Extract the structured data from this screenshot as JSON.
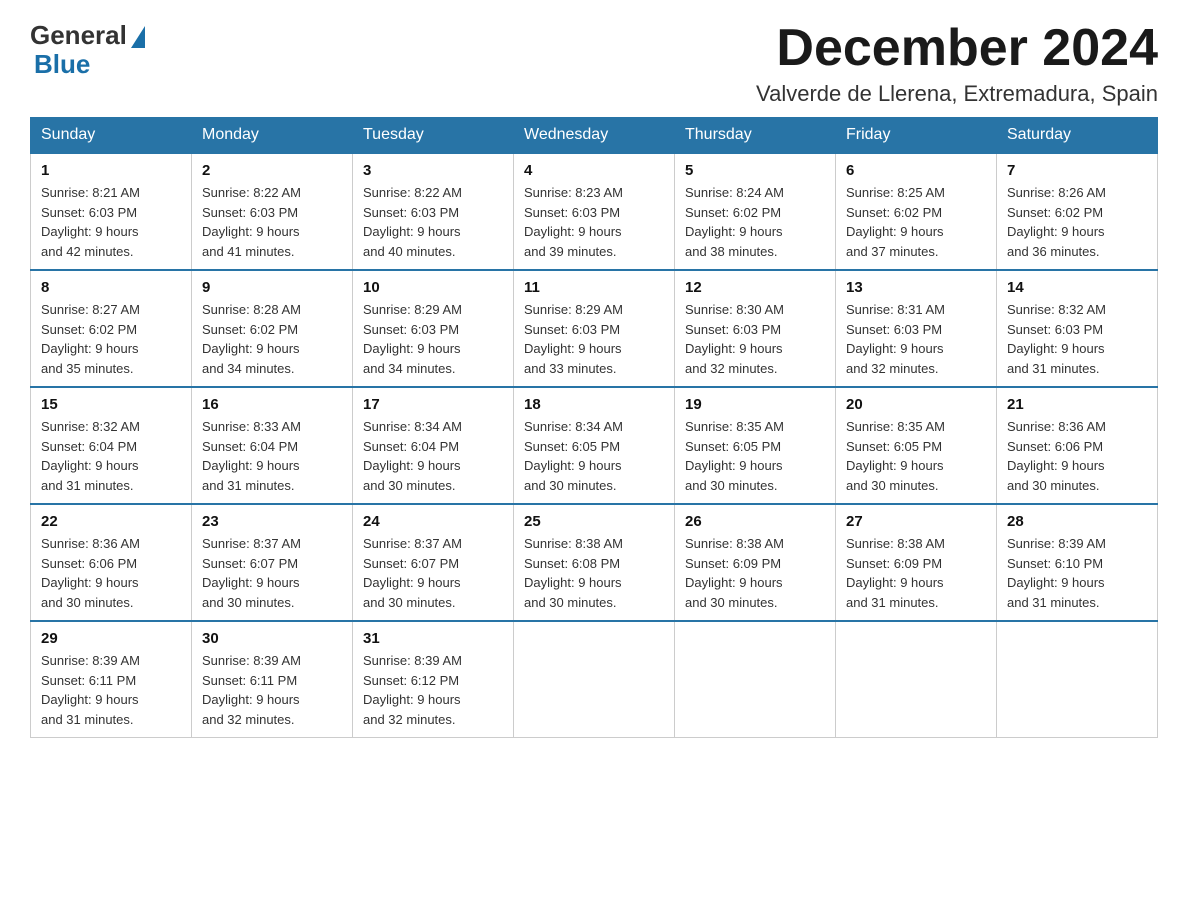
{
  "header": {
    "logo_general": "General",
    "logo_blue": "Blue",
    "month_title": "December 2024",
    "location": "Valverde de Llerena, Extremadura, Spain"
  },
  "weekdays": [
    "Sunday",
    "Monday",
    "Tuesday",
    "Wednesday",
    "Thursday",
    "Friday",
    "Saturday"
  ],
  "weeks": [
    [
      {
        "day": "1",
        "sunrise": "8:21 AM",
        "sunset": "6:03 PM",
        "daylight": "9 hours and 42 minutes."
      },
      {
        "day": "2",
        "sunrise": "8:22 AM",
        "sunset": "6:03 PM",
        "daylight": "9 hours and 41 minutes."
      },
      {
        "day": "3",
        "sunrise": "8:22 AM",
        "sunset": "6:03 PM",
        "daylight": "9 hours and 40 minutes."
      },
      {
        "day": "4",
        "sunrise": "8:23 AM",
        "sunset": "6:03 PM",
        "daylight": "9 hours and 39 minutes."
      },
      {
        "day": "5",
        "sunrise": "8:24 AM",
        "sunset": "6:02 PM",
        "daylight": "9 hours and 38 minutes."
      },
      {
        "day": "6",
        "sunrise": "8:25 AM",
        "sunset": "6:02 PM",
        "daylight": "9 hours and 37 minutes."
      },
      {
        "day": "7",
        "sunrise": "8:26 AM",
        "sunset": "6:02 PM",
        "daylight": "9 hours and 36 minutes."
      }
    ],
    [
      {
        "day": "8",
        "sunrise": "8:27 AM",
        "sunset": "6:02 PM",
        "daylight": "9 hours and 35 minutes."
      },
      {
        "day": "9",
        "sunrise": "8:28 AM",
        "sunset": "6:02 PM",
        "daylight": "9 hours and 34 minutes."
      },
      {
        "day": "10",
        "sunrise": "8:29 AM",
        "sunset": "6:03 PM",
        "daylight": "9 hours and 34 minutes."
      },
      {
        "day": "11",
        "sunrise": "8:29 AM",
        "sunset": "6:03 PM",
        "daylight": "9 hours and 33 minutes."
      },
      {
        "day": "12",
        "sunrise": "8:30 AM",
        "sunset": "6:03 PM",
        "daylight": "9 hours and 32 minutes."
      },
      {
        "day": "13",
        "sunrise": "8:31 AM",
        "sunset": "6:03 PM",
        "daylight": "9 hours and 32 minutes."
      },
      {
        "day": "14",
        "sunrise": "8:32 AM",
        "sunset": "6:03 PM",
        "daylight": "9 hours and 31 minutes."
      }
    ],
    [
      {
        "day": "15",
        "sunrise": "8:32 AM",
        "sunset": "6:04 PM",
        "daylight": "9 hours and 31 minutes."
      },
      {
        "day": "16",
        "sunrise": "8:33 AM",
        "sunset": "6:04 PM",
        "daylight": "9 hours and 31 minutes."
      },
      {
        "day": "17",
        "sunrise": "8:34 AM",
        "sunset": "6:04 PM",
        "daylight": "9 hours and 30 minutes."
      },
      {
        "day": "18",
        "sunrise": "8:34 AM",
        "sunset": "6:05 PM",
        "daylight": "9 hours and 30 minutes."
      },
      {
        "day": "19",
        "sunrise": "8:35 AM",
        "sunset": "6:05 PM",
        "daylight": "9 hours and 30 minutes."
      },
      {
        "day": "20",
        "sunrise": "8:35 AM",
        "sunset": "6:05 PM",
        "daylight": "9 hours and 30 minutes."
      },
      {
        "day": "21",
        "sunrise": "8:36 AM",
        "sunset": "6:06 PM",
        "daylight": "9 hours and 30 minutes."
      }
    ],
    [
      {
        "day": "22",
        "sunrise": "8:36 AM",
        "sunset": "6:06 PM",
        "daylight": "9 hours and 30 minutes."
      },
      {
        "day": "23",
        "sunrise": "8:37 AM",
        "sunset": "6:07 PM",
        "daylight": "9 hours and 30 minutes."
      },
      {
        "day": "24",
        "sunrise": "8:37 AM",
        "sunset": "6:07 PM",
        "daylight": "9 hours and 30 minutes."
      },
      {
        "day": "25",
        "sunrise": "8:38 AM",
        "sunset": "6:08 PM",
        "daylight": "9 hours and 30 minutes."
      },
      {
        "day": "26",
        "sunrise": "8:38 AM",
        "sunset": "6:09 PM",
        "daylight": "9 hours and 30 minutes."
      },
      {
        "day": "27",
        "sunrise": "8:38 AM",
        "sunset": "6:09 PM",
        "daylight": "9 hours and 31 minutes."
      },
      {
        "day": "28",
        "sunrise": "8:39 AM",
        "sunset": "6:10 PM",
        "daylight": "9 hours and 31 minutes."
      }
    ],
    [
      {
        "day": "29",
        "sunrise": "8:39 AM",
        "sunset": "6:11 PM",
        "daylight": "9 hours and 31 minutes."
      },
      {
        "day": "30",
        "sunrise": "8:39 AM",
        "sunset": "6:11 PM",
        "daylight": "9 hours and 32 minutes."
      },
      {
        "day": "31",
        "sunrise": "8:39 AM",
        "sunset": "6:12 PM",
        "daylight": "9 hours and 32 minutes."
      },
      null,
      null,
      null,
      null
    ]
  ],
  "labels": {
    "sunrise": "Sunrise:",
    "sunset": "Sunset:",
    "daylight": "Daylight:"
  }
}
